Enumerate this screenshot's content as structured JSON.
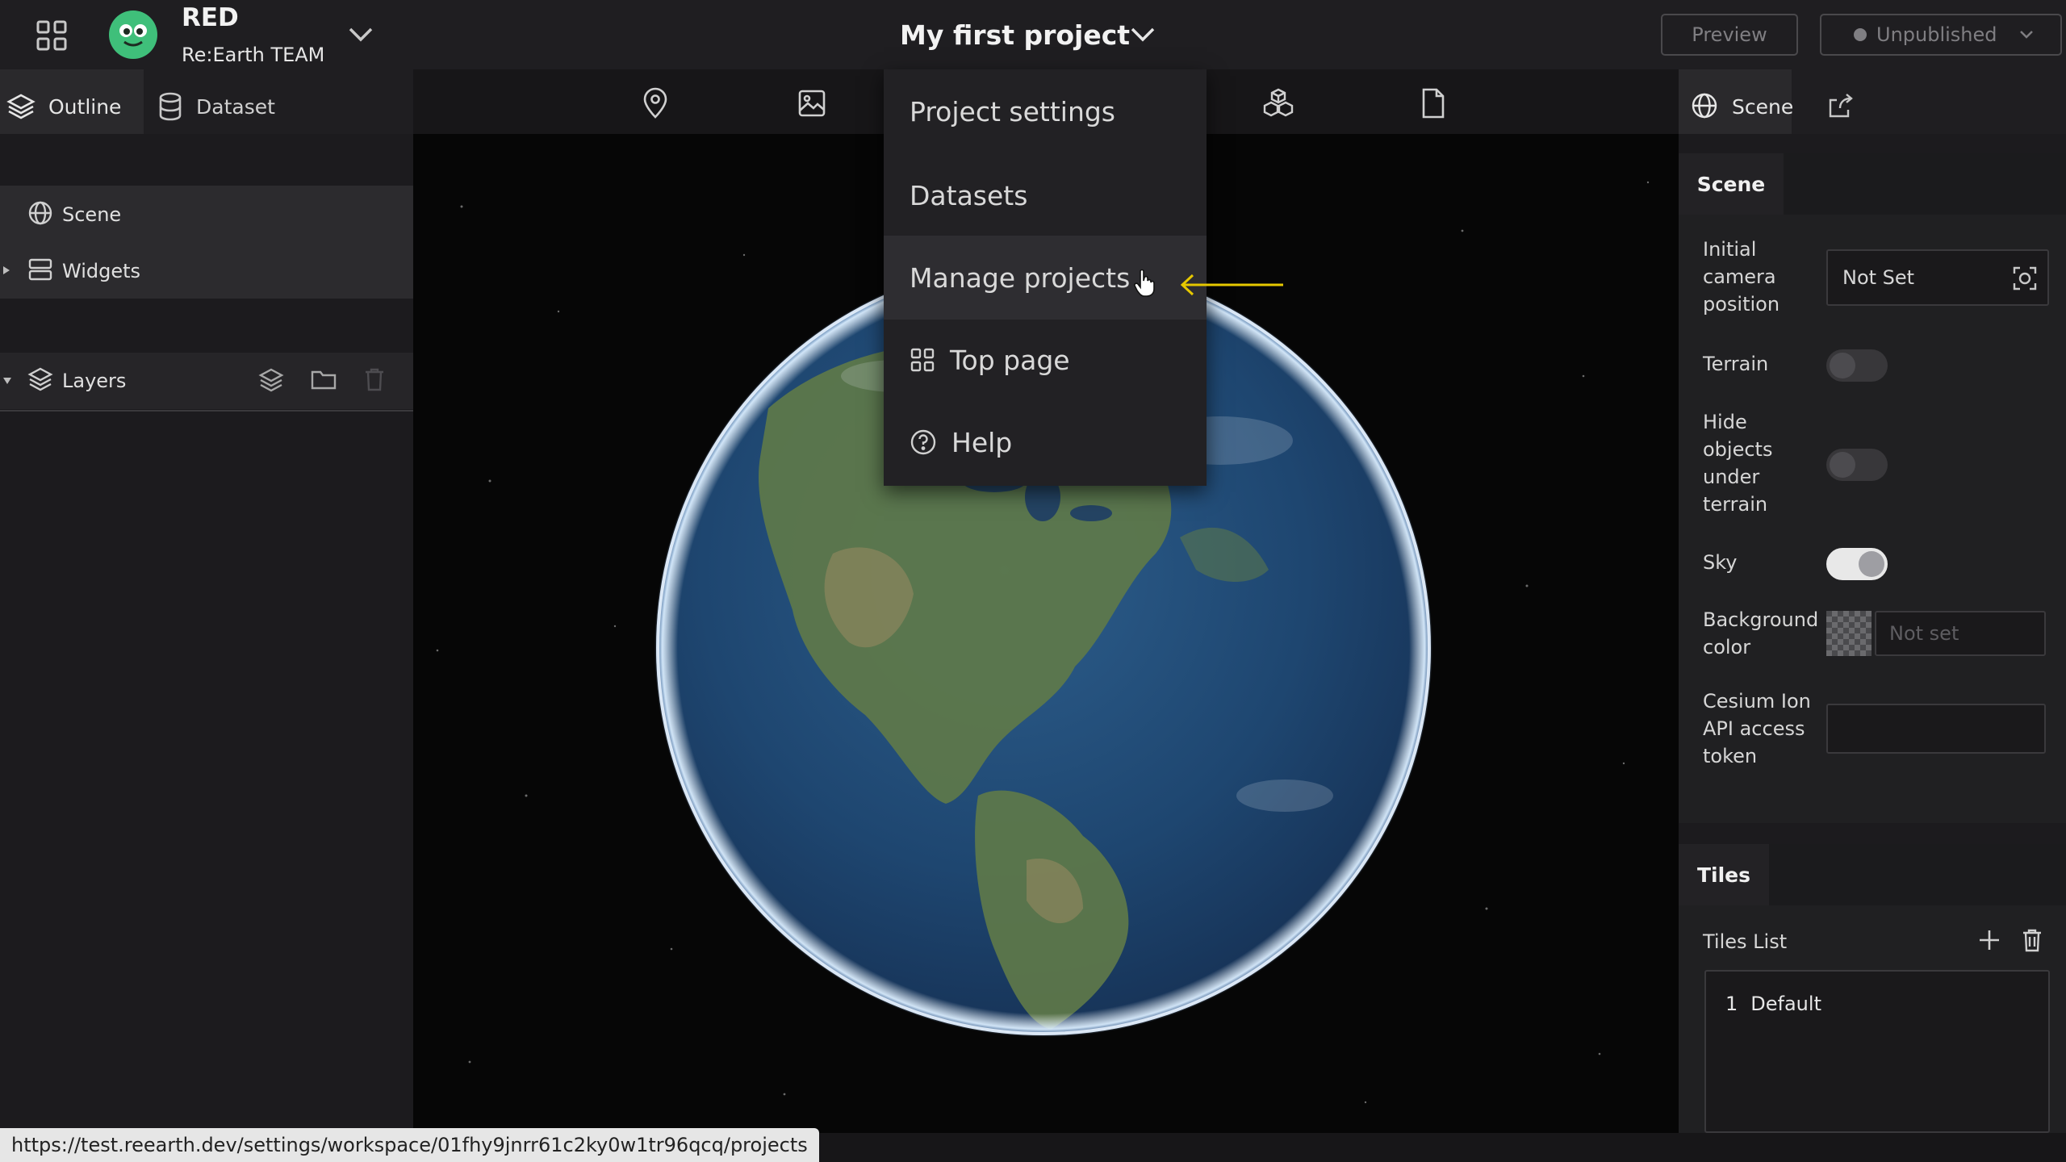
{
  "header": {
    "workspace_name": "RED",
    "team_name": "Re:Earth TEAM",
    "project_title": "My first project",
    "preview_label": "Preview",
    "publish_status": "Unpublished"
  },
  "left_panel": {
    "tabs": [
      {
        "label": "Outline"
      },
      {
        "label": "Dataset"
      }
    ],
    "items": [
      {
        "label": "Scene"
      },
      {
        "label": "Widgets"
      }
    ],
    "layers_label": "Layers"
  },
  "project_menu": {
    "items": [
      {
        "label": "Project settings"
      },
      {
        "label": "Datasets"
      },
      {
        "label": "Manage projects"
      },
      {
        "label": "Top page"
      },
      {
        "label": "Help"
      }
    ]
  },
  "right_panel": {
    "tab_label": "Scene",
    "scene_section": {
      "title": "Scene",
      "camera_label": "Initial camera position",
      "camera_value": "Not Set",
      "terrain_label": "Terrain",
      "terrain_on": false,
      "hide_objects_label": "Hide objects under terrain",
      "hide_objects_on": false,
      "sky_label": "Sky",
      "sky_on": true,
      "background_label": "Background color",
      "background_value": "Not set",
      "cesium_label": "Cesium Ion API access token",
      "cesium_value": ""
    },
    "tiles_section": {
      "title": "Tiles",
      "list_label": "Tiles List",
      "tiles": [
        {
          "index": "1",
          "name": "Default"
        }
      ]
    }
  },
  "status_url": "https://test.reearth.dev/settings/workspace/01fhy9jnrr61c2ky0w1tr96qcq/projects",
  "colors": {
    "accent_arrow": "#e6c800",
    "background": "#171618",
    "panel": "#1c1b1e"
  }
}
